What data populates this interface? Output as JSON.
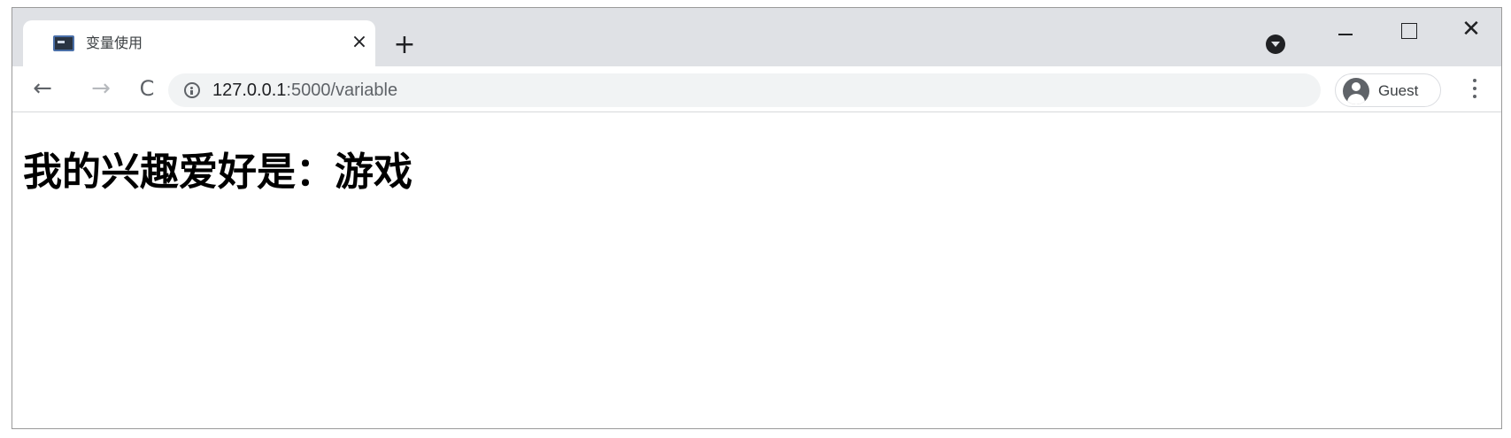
{
  "tab": {
    "title": "变量使用",
    "close_glyph": "×"
  },
  "new_tab_glyph": "+",
  "window_controls": {
    "close_glyph": "✕"
  },
  "toolbar": {
    "back_glyph": "←",
    "forward_glyph": "→",
    "reload_glyph": "C",
    "url_host": "127.0.0.1",
    "url_path": ":5000/variable",
    "profile_label": "Guest"
  },
  "page": {
    "heading": "我的兴趣爱好是：游戏"
  }
}
